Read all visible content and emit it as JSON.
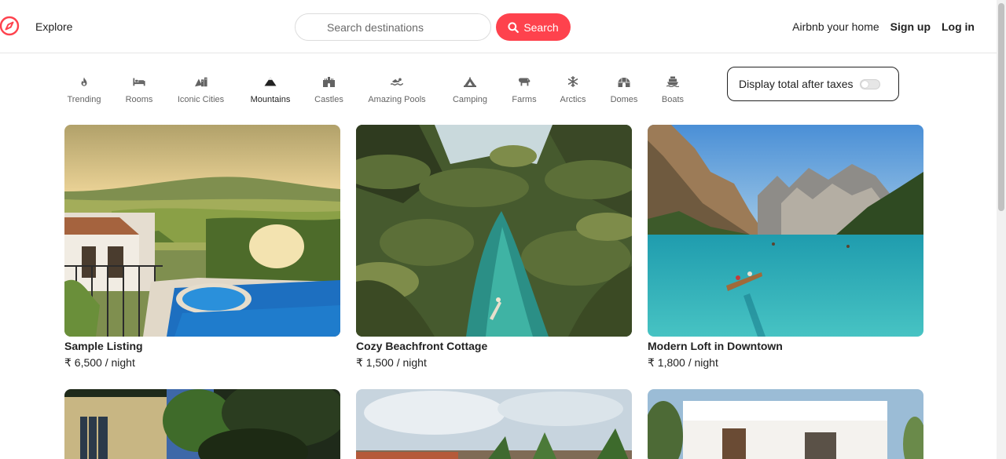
{
  "nav": {
    "logo_icon": "compass-icon",
    "explore": "Explore",
    "search_placeholder": "Search destinations",
    "search_button": "Search",
    "host": "Airbnb your home",
    "signup": "Sign up",
    "login": "Log in"
  },
  "filters": [
    {
      "label": "Trending",
      "icon": "fire-icon"
    },
    {
      "label": "Rooms",
      "icon": "bed-icon"
    },
    {
      "label": "Iconic Cities",
      "icon": "mountain-city-icon"
    },
    {
      "label": "Mountains",
      "icon": "mountain-icon"
    },
    {
      "label": "Castles",
      "icon": "fort-icon"
    },
    {
      "label": "Amazing Pools",
      "icon": "swimmer-icon"
    },
    {
      "label": "Camping",
      "icon": "campground-icon"
    },
    {
      "label": "Farms",
      "icon": "cow-icon"
    },
    {
      "label": "Arctics",
      "icon": "snowflake-icon"
    },
    {
      "label": "Domes",
      "icon": "igloo-icon"
    },
    {
      "label": "Boats",
      "icon": "ship-icon"
    }
  ],
  "active_filter": "Mountains",
  "tax_toggle": {
    "label": "Display total after taxes",
    "enabled": false
  },
  "listings": [
    {
      "title": "Sample Listing",
      "price": "₹ 6,500 / night"
    },
    {
      "title": "Cozy Beachfront Cottage",
      "price": "₹ 1,500 / night"
    },
    {
      "title": "Modern Loft in Downtown",
      "price": "₹ 1,800 / night"
    },
    {
      "title": "",
      "price": ""
    },
    {
      "title": "",
      "price": ""
    },
    {
      "title": "",
      "price": ""
    }
  ],
  "colors": {
    "brand": "#fe424d",
    "text": "#222222",
    "border": "#dcdcdc"
  }
}
